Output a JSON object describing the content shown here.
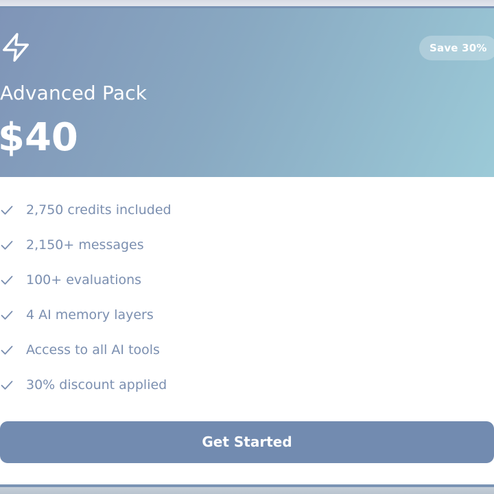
{
  "plan": {
    "badge": "Save 30%",
    "title": "Advanced Pack",
    "price": "$40",
    "icon": "lightning-bolt-icon"
  },
  "features": [
    {
      "label": "2,750 credits included",
      "icon": "check-icon"
    },
    {
      "label": "2,150+ messages",
      "icon": "check-icon"
    },
    {
      "label": "100+ evaluations",
      "icon": "check-icon"
    },
    {
      "label": "4 AI memory layers",
      "icon": "check-icon"
    },
    {
      "label": "Access to all AI tools",
      "icon": "check-icon"
    },
    {
      "label": "30% discount applied",
      "icon": "check-icon"
    }
  ],
  "cta": {
    "label": "Get Started"
  },
  "colors": {
    "header_gradient_start": "#7f94b7",
    "header_gradient_end": "#9ccbd8",
    "feature_text": "#7b8fb0",
    "button": "#728bb0",
    "border": "#7a93b4"
  }
}
